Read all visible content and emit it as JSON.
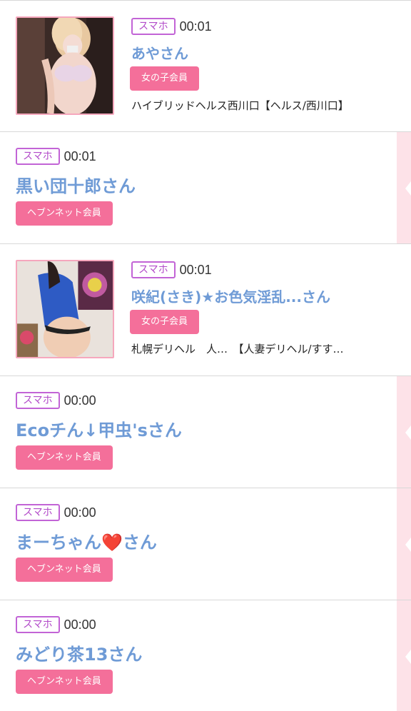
{
  "colors": {
    "badge_border": "#c264d6",
    "name_blue": "#6f9bd6",
    "member_pink": "#f46f9a",
    "thumb_border": "#f6a7bd",
    "strip_pink": "#fde2e8"
  },
  "rows": [
    {
      "device": "スマホ",
      "time": "00:01",
      "name": "あやさん",
      "member": "女の子会員",
      "shop": "ハイブリッドヘルス西川口【ヘルス/西川口】",
      "thumb_icon": "girl-photo-icon"
    },
    {
      "device": "スマホ",
      "time": "00:01",
      "name": "黒い団十郎さん",
      "member": "ヘブンネット会員"
    },
    {
      "device": "スマホ",
      "time": "00:01",
      "name": "咲紀(さき)★お色気淫乱...さん",
      "member": "女の子会員",
      "shop": "札幌デリヘル　人…　【人妻デリヘル/すす…",
      "thumb_icon": "girl-photo-icon"
    },
    {
      "device": "スマホ",
      "time": "00:00",
      "name": "Ecoチん↓甲虫'sさん",
      "member": "ヘブンネット会員"
    },
    {
      "device": "スマホ",
      "time": "00:00",
      "name": "まーちゃん❤️さん",
      "member": "ヘブンネット会員"
    },
    {
      "device": "スマホ",
      "time": "00:00",
      "name": "みどり茶13さん",
      "member": "ヘブンネット会員"
    }
  ]
}
